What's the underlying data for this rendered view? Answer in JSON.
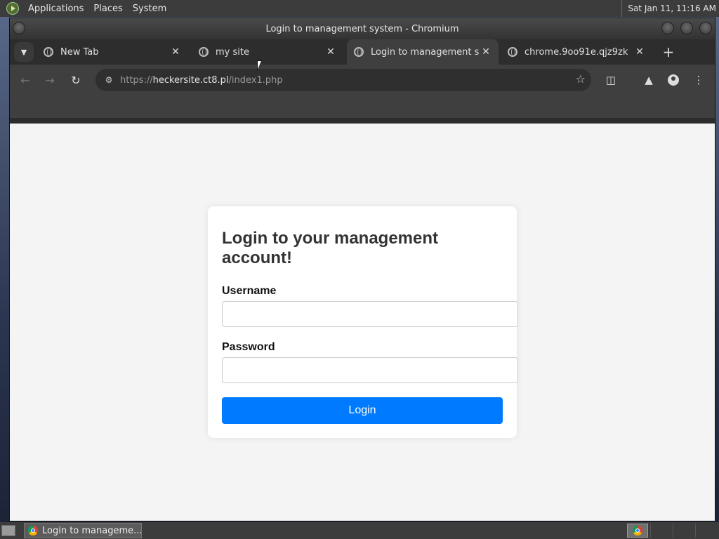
{
  "top_panel": {
    "menus": [
      "Applications",
      "Places",
      "System"
    ],
    "clock": "Sat Jan 11, 11:16 AM"
  },
  "window": {
    "title": "Login to management system - Chromium"
  },
  "tabs": [
    {
      "title": "New Tab",
      "active": false
    },
    {
      "title": "my site",
      "active": false
    },
    {
      "title": "Login to management system",
      "active": true
    },
    {
      "title": "chrome.9oo91e.qjz9zk",
      "active": false
    }
  ],
  "toolbar": {
    "url_scheme": "https://",
    "url_host": "heckersite.ct8.pl",
    "url_path": "/index1.php"
  },
  "page": {
    "heading": "Login to your management account!",
    "username_label": "Username",
    "username_value": "",
    "password_label": "Password",
    "password_value": "",
    "login_button": "Login"
  },
  "taskbar": {
    "task_label": "Login to manageme..."
  },
  "icons": {
    "back": "arrow-left-icon",
    "forward": "arrow-right-icon",
    "reload": "reload-icon",
    "bookmark": "star-icon",
    "extensions": "puzzle-icon",
    "labs": "flask-icon",
    "profile": "profile-icon",
    "menu": "kebab-menu-icon"
  },
  "colors": {
    "login_button": "#007bff",
    "page_background": "#f4f4f4",
    "browser_chrome": "#3f3f3f"
  }
}
